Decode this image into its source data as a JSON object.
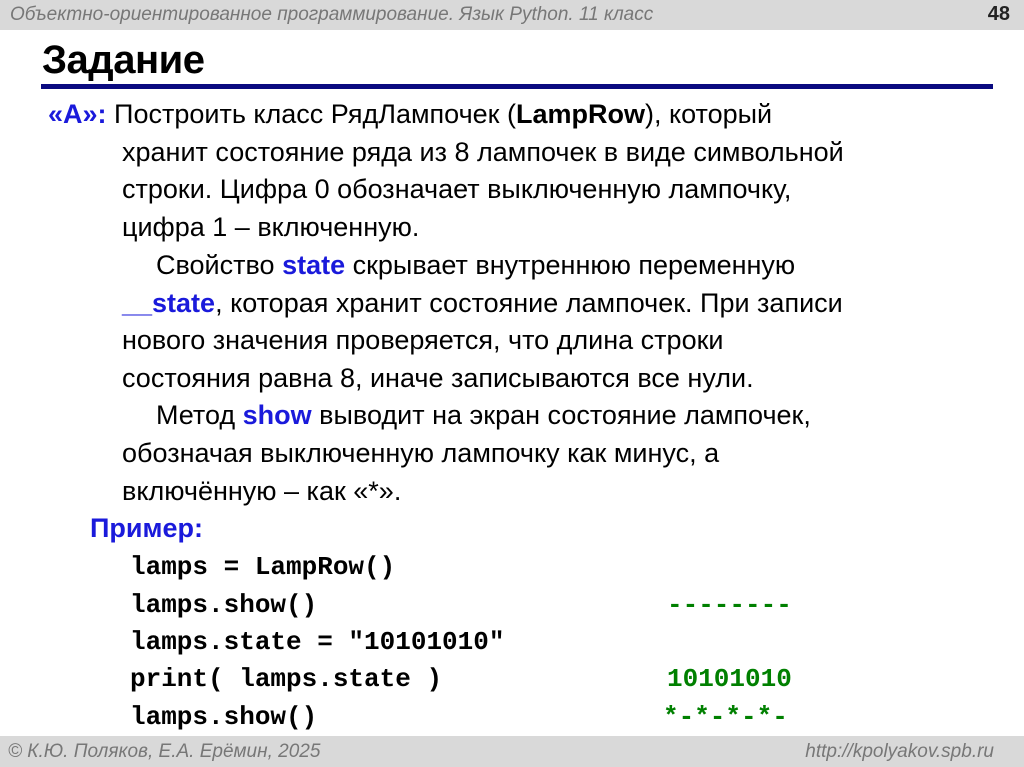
{
  "header": {
    "course": "Объектно-ориентированное программирование. Язык Python. 11 класс",
    "slide_number": "48"
  },
  "title": "Задание",
  "task": {
    "label": "«A»:",
    "l1a": "Построить класс РядЛампочек (",
    "l1b": "LampRow",
    "l1c": "), который",
    "l2": "хранит состояние ряда из 8 лампочек в виде символьной",
    "l3": "строки. Цифра 0 обозначает выключенную лампочку,",
    "l4": "цифра 1 – включенную.",
    "l5a": "Свойство ",
    "l5b": "state",
    "l5c": " скрывает внутреннюю переменную",
    "l6a": "__state",
    "l6b": ", которая хранит состояние лампочек. При записи",
    "l7": "нового значения проверяется, что длина строки",
    "l8": "состояния равна 8, иначе записываются все нули.",
    "l9a": "Метод ",
    "l9b": "show",
    "l9c": " выводит на экран состояние лампочек,",
    "l10": "обозначая выключенную лампочку как минус, а",
    "l11": "включённую – как «*»."
  },
  "example": {
    "label": "Пример",
    "code": [
      "lamps = LampRow()",
      "lamps.show()",
      "lamps.state = \"10101010\"",
      "print( lamps.state )",
      "lamps.show()"
    ],
    "output": [
      "--------",
      "10101010",
      "*-*-*-*-"
    ]
  },
  "footer": {
    "copyright": "© К.Ю. Поляков, Е.А. Ерёмин, 2025",
    "url": "http://kpolyakov.spb.ru"
  },
  "colors": {
    "accent": "#1a1adb",
    "output": "#008000",
    "rule": "#0a0a80"
  }
}
